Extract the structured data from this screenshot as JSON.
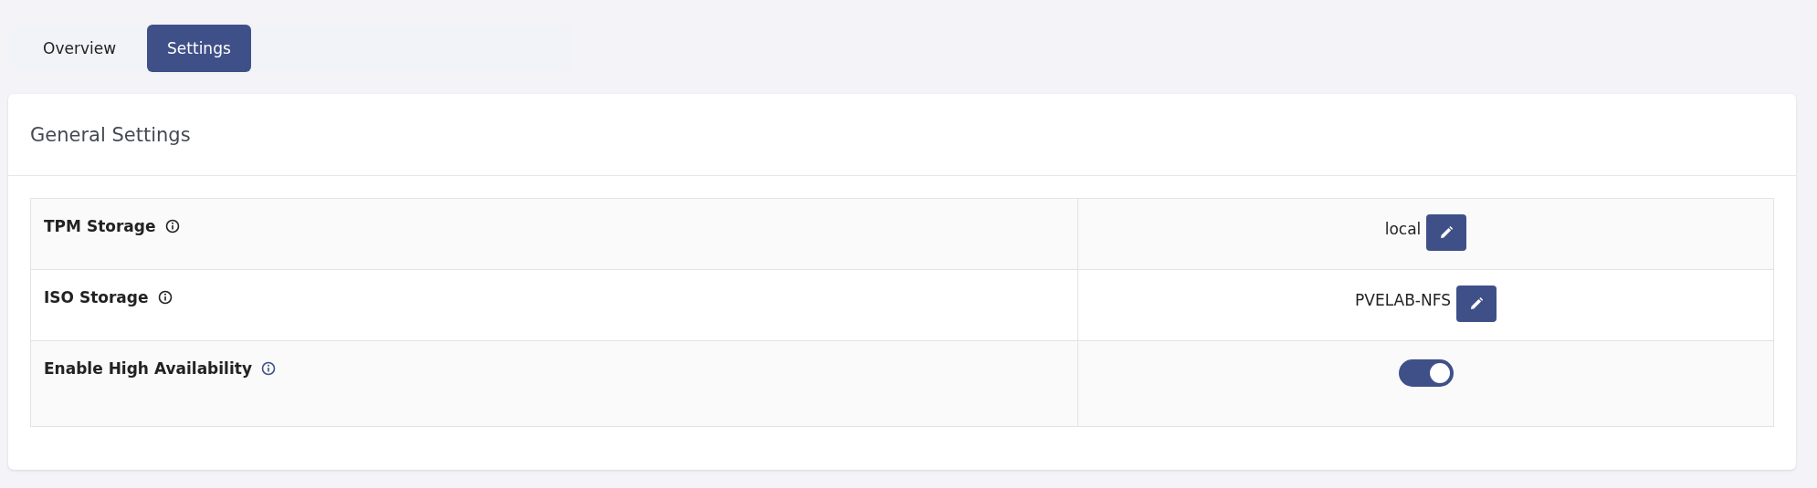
{
  "tabs": [
    {
      "label": "Overview",
      "selected": false
    },
    {
      "label": "Settings",
      "selected": true
    }
  ],
  "card": {
    "title": "General Settings"
  },
  "settings": [
    {
      "label": "TPM Storage",
      "kind": "edit",
      "value": "local",
      "color": "#222222"
    },
    {
      "label": "ISO Storage",
      "kind": "edit",
      "value": "PVELAB-NFS",
      "color": "#222222"
    },
    {
      "label": "Enable High Availability",
      "kind": "toggle",
      "on": true,
      "color": "#3f5088"
    }
  ]
}
